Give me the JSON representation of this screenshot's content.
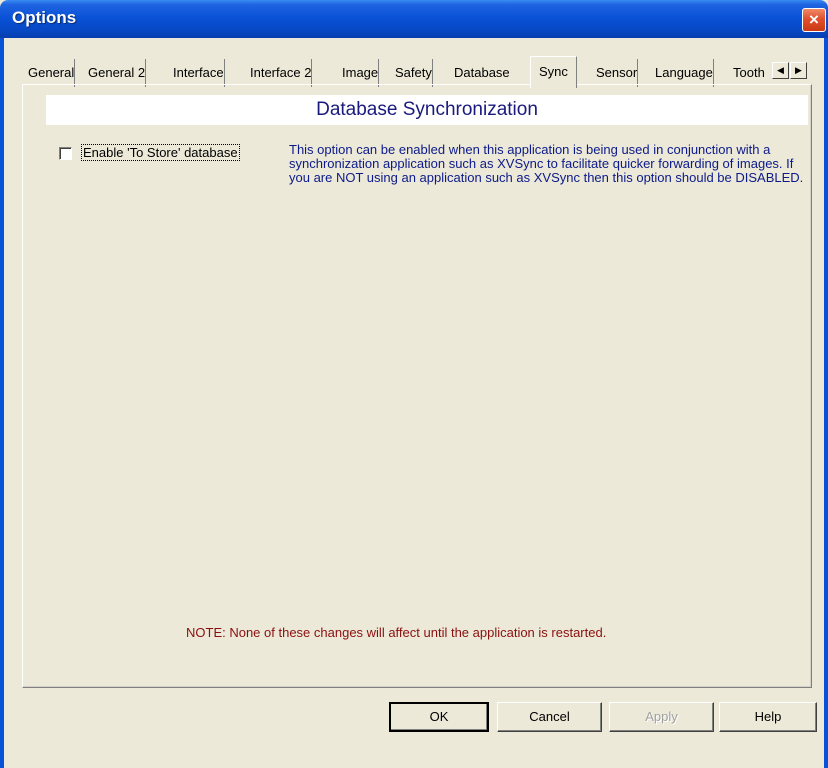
{
  "window": {
    "title": "Options",
    "close_icon": "×"
  },
  "tabs": [
    {
      "label": "General",
      "active": false
    },
    {
      "label": "General 2",
      "active": false
    },
    {
      "label": "Interface",
      "active": false
    },
    {
      "label": "Interface 2",
      "active": false
    },
    {
      "label": "Image",
      "active": false
    },
    {
      "label": "Safety",
      "active": false
    },
    {
      "label": "Database",
      "active": false
    },
    {
      "label": "Sync",
      "active": true
    },
    {
      "label": "Sensor",
      "active": false
    },
    {
      "label": "Language",
      "active": false
    },
    {
      "label": "Tooth",
      "active": false
    }
  ],
  "tab_scroll": {
    "left": "◀",
    "right": "▶"
  },
  "page": {
    "heading": "Database Synchronization",
    "checkbox_label": "Enable 'To Store' database",
    "checkbox_checked": false,
    "description": "This option can be enabled when this application is being used in conjunction with a synchronization application such as XVSync to facilitate quicker forwarding of images.  If you are NOT using an application such as XVSync then this option should be DISABLED.",
    "note": "NOTE: None of these changes will affect until the application is restarted."
  },
  "buttons": {
    "ok": "OK",
    "cancel": "Cancel",
    "apply": "Apply",
    "help": "Help"
  },
  "colors": {
    "titlebar": "#0a52d8",
    "heading": "#1a1a7e",
    "description": "#0c1a8a",
    "note": "#8a1010"
  }
}
